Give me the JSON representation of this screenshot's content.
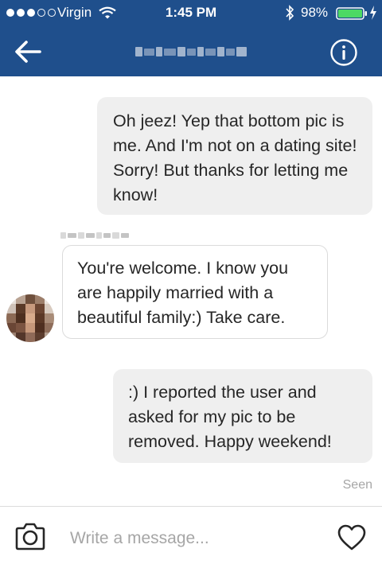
{
  "status_bar": {
    "carrier": "Virgin",
    "time": "1:45 PM",
    "battery": "98%",
    "signal_icon": "signal-dots-icon",
    "wifi_icon": "wifi-icon",
    "bluetooth_icon": "bluetooth-icon",
    "battery_icon": "battery-icon",
    "charging_icon": "charging-bolt-icon"
  },
  "header": {
    "back_icon": "back-arrow-icon",
    "info_icon": "info-icon",
    "background": "#1f4f8c"
  },
  "messages": [
    {
      "direction": "outgoing",
      "text": "Oh jeez! Yep that bottom pic is me. And I'm not on a dating site! Sorry! But thanks for letting me know!"
    },
    {
      "direction": "incoming",
      "text": "You're welcome. I know you are happily married with a beautiful family:) Take care."
    },
    {
      "direction": "outgoing",
      "text": ":) I reported the user and asked for my pic to be removed. Happy weekend!"
    }
  ],
  "seen_label": "Seen",
  "composer": {
    "placeholder": "Write a message...",
    "camera_icon": "camera-icon",
    "heart_icon": "heart-icon"
  },
  "colors": {
    "header": "#1f4f8c",
    "outgoing_bubble": "#efefef",
    "incoming_border": "#dbdbdb",
    "muted_text": "#a6a6a6"
  }
}
